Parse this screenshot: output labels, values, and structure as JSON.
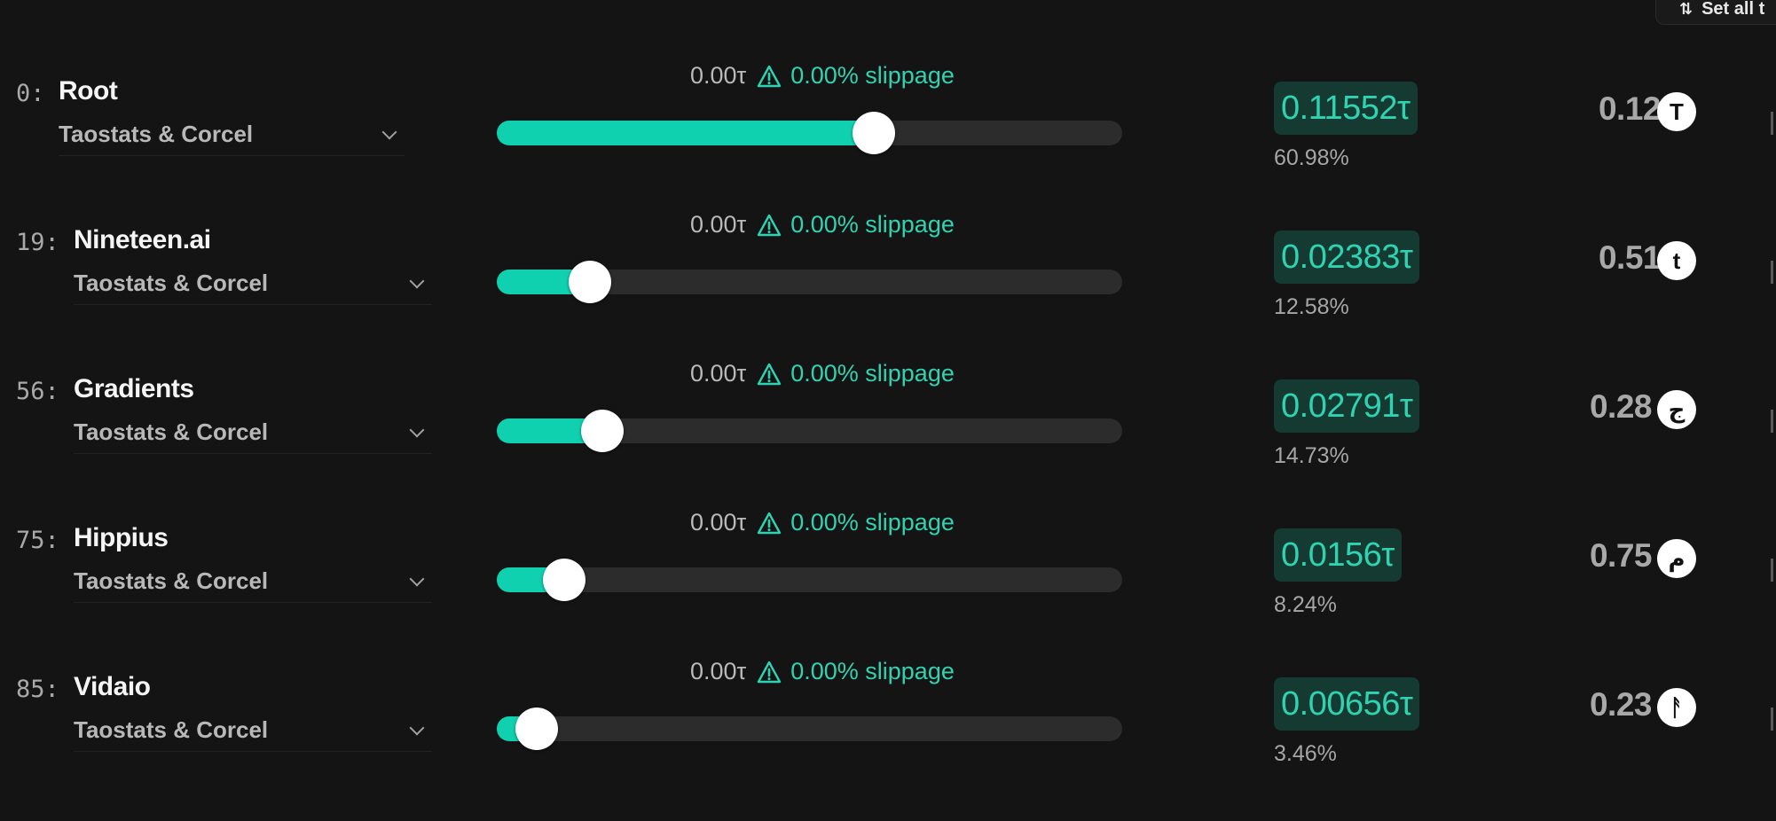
{
  "header": {
    "set_all_label": "Set all t",
    "set_all_icon": "sort-arrows-icon"
  },
  "rows": [
    {
      "netuid": "0:",
      "name": "Root",
      "validator": "Taostats & Corcel",
      "fee": "0.00τ",
      "slippage": "0.00% slippage",
      "slider_fraction": 0.6098,
      "allocation": "0.11552τ",
      "allocation_pct": "60.98%",
      "price": "0.12",
      "token_symbol": "T"
    },
    {
      "netuid": "19:",
      "name": "Nineteen.ai",
      "validator": "Taostats & Corcel",
      "fee": "0.00τ",
      "slippage": "0.00% slippage",
      "slider_fraction": 0.1258,
      "allocation": "0.02383τ",
      "allocation_pct": "12.58%",
      "price": "0.51",
      "token_symbol": "t"
    },
    {
      "netuid": "56:",
      "name": "Gradients",
      "validator": "Taostats & Corcel",
      "fee": "0.00τ",
      "slippage": "0.00% slippage",
      "slider_fraction": 0.1473,
      "allocation": "0.02791τ",
      "allocation_pct": "14.73%",
      "price": "0.28",
      "token_symbol": "ج"
    },
    {
      "netuid": "75:",
      "name": "Hippius",
      "validator": "Taostats & Corcel",
      "fee": "0.00τ",
      "slippage": "0.00% slippage",
      "slider_fraction": 0.0824,
      "allocation": "0.0156τ",
      "allocation_pct": "8.24%",
      "price": "0.75",
      "token_symbol": "م"
    },
    {
      "netuid": "85:",
      "name": "Vidaio",
      "validator": "Taostats & Corcel",
      "fee": "0.00τ",
      "slippage": "0.00% slippage",
      "slider_fraction": 0.0346,
      "allocation": "0.00656τ",
      "allocation_pct": "3.46%",
      "price": "0.23",
      "token_symbol": "ᚨ"
    }
  ],
  "colors": {
    "accent": "#0fd1b0",
    "accent_text": "#2fd3b2",
    "badge_bg": "#143a31",
    "track": "#2c2c2c",
    "background": "#141414"
  }
}
